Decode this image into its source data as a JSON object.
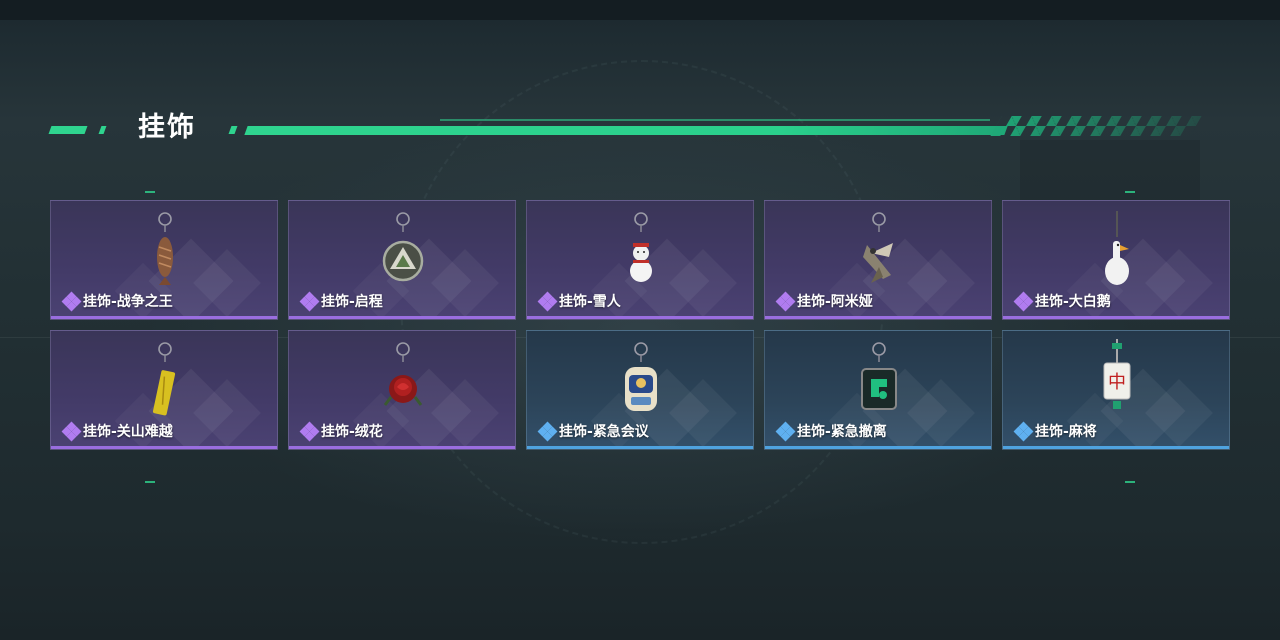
{
  "page": {
    "title": "挂饰",
    "accent_color": "#2fd48f"
  },
  "items": [
    {
      "name": "挂饰-战争之王",
      "rarity": "purple",
      "icon": "fish-charm-icon"
    },
    {
      "name": "挂饰-启程",
      "rarity": "purple",
      "icon": "triangle-medallion-charm-icon"
    },
    {
      "name": "挂饰-雪人",
      "rarity": "purple",
      "icon": "snowman-charm-icon"
    },
    {
      "name": "挂饰-阿米娅",
      "rarity": "purple",
      "icon": "bird-charm-icon"
    },
    {
      "name": "挂饰-大白鹅",
      "rarity": "purple",
      "icon": "white-goose-charm-icon"
    },
    {
      "name": "挂饰-关山难越",
      "rarity": "purple",
      "icon": "gold-bar-charm-icon"
    },
    {
      "name": "挂饰-绒花",
      "rarity": "purple",
      "icon": "red-rose-charm-icon"
    },
    {
      "name": "挂饰-紧急会议",
      "rarity": "blue",
      "icon": "meeting-badge-charm-icon"
    },
    {
      "name": "挂饰-紧急撤离",
      "rarity": "blue",
      "icon": "green-cube-charm-icon"
    },
    {
      "name": "挂饰-麻将",
      "rarity": "blue",
      "icon": "mahjong-tile-charm-icon"
    }
  ],
  "rarity_colors": {
    "purple": "#9a6ee0",
    "blue": "#4fa3e0"
  }
}
